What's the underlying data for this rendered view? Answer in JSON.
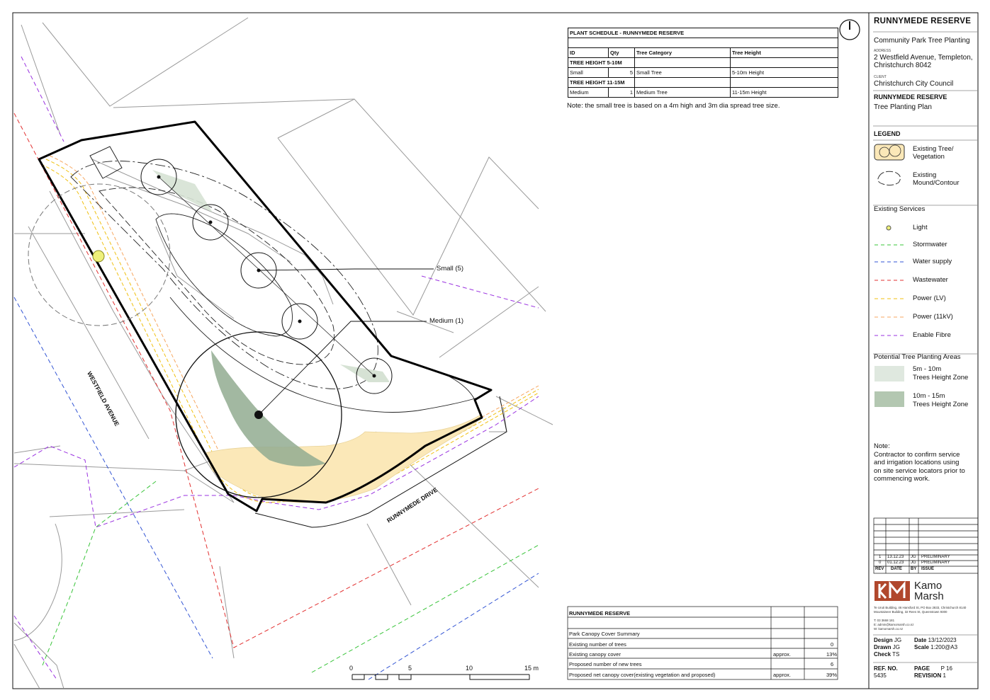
{
  "project": {
    "name": "RUNNYMEDE RESERVE",
    "subtitle": "Community Park Tree Planting",
    "address_label": "ADDRESS",
    "address_line1": "2 Westfield Avenue, Templeton,",
    "address_line2": "Christchurch 8042",
    "client_label": "CLIENT",
    "client": "Christchurch City Council",
    "drawing_title": "RUNNYMEDE RESERVE",
    "drawing_subtitle": "Tree Planting Plan"
  },
  "legend": {
    "title": "LEGEND",
    "existing_tree": "Existing Tree/",
    "existing_tree2": "Vegetation",
    "mound": "Existing",
    "mound2": "Mound/Contour",
    "services_title": "Existing Services",
    "services": [
      {
        "label": "Light",
        "color": "#e8ef6b"
      },
      {
        "label": "Stormwater",
        "color": "#39c43a"
      },
      {
        "label": "Water supply",
        "color": "#3355d4"
      },
      {
        "label": "Wastewater",
        "color": "#e23030"
      },
      {
        "label": "Power (LV)",
        "color": "#f0c010"
      },
      {
        "label": "Power (11kV)",
        "color": "#f7a760"
      },
      {
        "label": "Enable Fibre",
        "color": "#9a32e0"
      }
    ],
    "planting_title": "Potential Tree Planting Areas",
    "zone1_a": "5m - 10m",
    "zone1_b": "Trees Height Zone",
    "zone2_a": "10m - 15m",
    "zone2_b": "Trees Height Zone",
    "zone1_color": "#dfe8df",
    "zone2_color": "#b3c7b1"
  },
  "note": {
    "title": "Note:",
    "l1": "Contractor to confirm service",
    "l2": "and irrigation locations using",
    "l3": "on site service locators prior to",
    "l4": "commencing work."
  },
  "revisions": {
    "rows": [
      {
        "rev": "1",
        "date": "13.12.23",
        "by": "JG",
        "issue": "PRELIMINARY"
      },
      {
        "rev": "0",
        "date": "01.12.23",
        "by": "JG",
        "issue": "PRELIMINARY"
      }
    ],
    "h_rev": "REV",
    "h_date": "DATE",
    "h_by": "BY",
    "h_issue": "ISSUE"
  },
  "company": {
    "name1": "Kamo",
    "name2": "Marsh",
    "addr1": "Te Uruti Building, 46 Hansford St, PO Box 2833, Christchurch 8140",
    "addr2": "Mountaineer Building, 32 Rees St, Queenstown 9300",
    "phone": "T: 03 3668 181",
    "email": "E: admin@kamomarsh.co.nz",
    "web": "W: kamomarsh.co.nz",
    "brand_color": "#b0472c"
  },
  "meta": {
    "design_label": "Design",
    "design": "JG",
    "drawn_label": "Drawn",
    "drawn": "JG",
    "check_label": "Check",
    "check": "TS",
    "date_label": "Date",
    "date": "13/12/2023",
    "scale_label": "Scale",
    "scale": "1:200@A3",
    "ref_label": "REF. NO.",
    "ref": "5435",
    "page_label": "PAGE",
    "page": "P 16",
    "revision_label": "REVISION",
    "revision": "1"
  },
  "schedule": {
    "title": "PLANT SCHEDULE - RUNNYMEDE RESERVE",
    "h_id": "ID",
    "h_qty": "Qty",
    "h_cat": "Tree Category",
    "h_height": "Tree Height",
    "group1": "TREE HEIGHT 5-10M",
    "row1": {
      "id": "Small",
      "qty": "5",
      "cat": "Small Tree",
      "height": "5-10m Height"
    },
    "group2": "TREE HEIGHT 11-15M",
    "row2": {
      "id": "Medium",
      "qty": "1",
      "cat": "Medium Tree",
      "height": "11-15m Height"
    },
    "note": "Note: the small tree is based on a 4m high and 3m dia spread tree size."
  },
  "canopy": {
    "title": "RUNNYMEDE RESERVE",
    "summary": "Park Canopy Cover Summary",
    "r1_label": "Existing number of trees",
    "r1_val": "0",
    "r2_label": "Existing canopy cover",
    "r2_q": "approx.",
    "r2_val": "13%",
    "r3_label": "Proposed number of new trees",
    "r3_val": "6",
    "r4_label": "Proposed net canopy cover(existing vegetation and proposed)",
    "r4_q": "approx.",
    "r4_val": "39%"
  },
  "plan": {
    "street1": "WESTFIELD AVENUE",
    "street2": "RUNNYMEDE DRIVE",
    "callout_small": "Small  (5)",
    "callout_medium": "Medium (1)",
    "scale_0": "0",
    "scale_5": "5",
    "scale_10": "10",
    "scale_15": "15 m"
  }
}
